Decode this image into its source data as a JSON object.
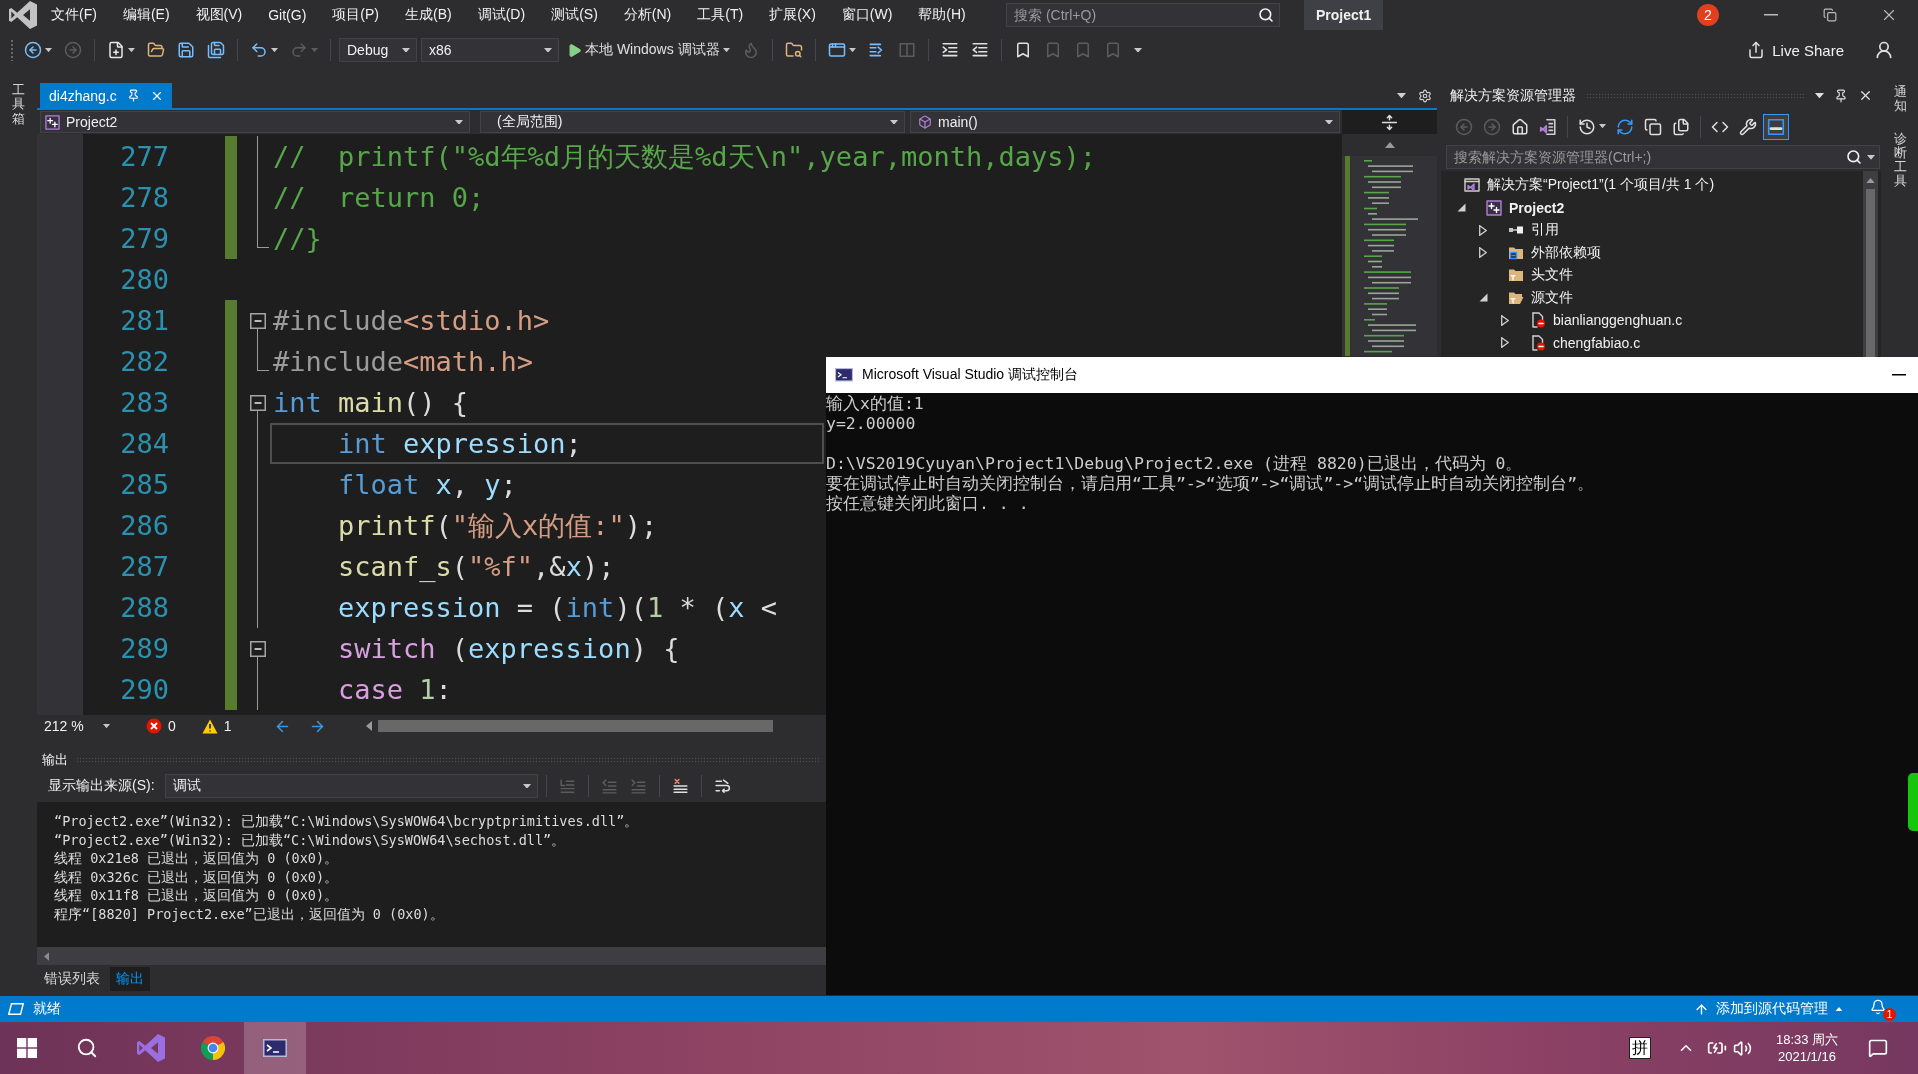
{
  "title_bar": {
    "menus": [
      "文件(F)",
      "编辑(E)",
      "视图(V)",
      "Git(G)",
      "项目(P)",
      "生成(B)",
      "调试(D)",
      "测试(S)",
      "分析(N)",
      "工具(T)",
      "扩展(X)",
      "窗口(W)",
      "帮助(H)"
    ],
    "search": {
      "placeholder": "搜索 (Ctrl+Q)"
    },
    "solution": "Project1",
    "badge": "2"
  },
  "toolbar": {
    "groups": [
      [
        {
          "kind": "back",
          "disabled": false
        },
        {
          "kind": "forward",
          "disabled": true
        }
      ],
      [
        {
          "kind": "new-item",
          "disabled": false
        },
        {
          "kind": "open",
          "disabled": false
        },
        {
          "kind": "save",
          "disabled": false
        },
        {
          "kind": "save-all",
          "disabled": false
        }
      ],
      [
        {
          "kind": "undo",
          "disabled": false
        },
        {
          "kind": "redo",
          "disabled": true
        }
      ],
      [
        {
          "kind": "configuration",
          "text": "Debug"
        },
        {
          "kind": "platform",
          "text": "x86"
        },
        {
          "kind": "run",
          "text": "本地 Windows 调试器"
        },
        {
          "kind": "hot-reload",
          "disabled": true
        }
      ],
      [
        {
          "kind": "find-in-folder",
          "disabled": false
        }
      ],
      [
        {
          "kind": "browser",
          "disabled": false
        },
        {
          "kind": "step-into",
          "disabled": false
        },
        {
          "kind": "step-out",
          "disabled": true
        }
      ],
      [
        {
          "kind": "indent",
          "disabled": false
        },
        {
          "kind": "outdent",
          "disabled": false
        }
      ],
      [
        {
          "kind": "bookmark",
          "disabled": false
        },
        {
          "kind": "previous-bookmark",
          "disabled": true
        },
        {
          "kind": "next-bookmark",
          "disabled": true
        },
        {
          "kind": "clear-bookmarks",
          "disabled": true
        }
      ]
    ],
    "live_share": "Live Share"
  },
  "toolbox": {
    "label": "工具箱"
  },
  "editor": {
    "tab": {
      "title": "di4zhang.c",
      "selected": true
    },
    "navigation": {
      "project": "Project2",
      "scope": "(全局范围)",
      "member": "main()"
    },
    "lines": [
      {
        "number": "277",
        "kind": "inside",
        "changed": true,
        "current": false,
        "indented": false,
        "tokens": [
          {
            "kind": "comment",
            "text": "//  printf(\"%d年%d月的天数是%d天\\n\",year,month,days);"
          }
        ]
      },
      {
        "number": "278",
        "kind": "inside",
        "changed": true,
        "current": false,
        "indented": false,
        "tokens": [
          {
            "kind": "comment",
            "text": "//  return 0;"
          }
        ]
      },
      {
        "number": "279",
        "kind": "end",
        "changed": true,
        "current": false,
        "indented": false,
        "tokens": [
          {
            "kind": "comment",
            "text": "//}"
          }
        ]
      },
      {
        "number": "280",
        "kind": "outside",
        "changed": false,
        "current": false
      },
      {
        "number": "281",
        "kind": "start",
        "changed": true,
        "current": false,
        "indented": false,
        "tokens": [
          {
            "kind": "preproc",
            "text": "#include"
          },
          {
            "kind": "string",
            "text": "<stdio.h>"
          }
        ]
      },
      {
        "number": "282",
        "kind": "end",
        "changed": true,
        "current": false,
        "indented": false,
        "tokens": [
          {
            "kind": "preproc",
            "text": "#include"
          },
          {
            "kind": "string",
            "text": "<math.h>"
          }
        ]
      },
      {
        "number": "283",
        "kind": "start",
        "changed": true,
        "current": false,
        "indented": false,
        "tokens": [
          {
            "kind": "keyword",
            "text": "int "
          },
          {
            "kind": "function",
            "text": "main"
          },
          {
            "kind": "plain",
            "text": "() {"
          }
        ]
      },
      {
        "number": "284",
        "kind": "inside",
        "changed": true,
        "current": true,
        "indented": true,
        "tokens": [
          {
            "kind": "keyword",
            "text": "int "
          },
          {
            "kind": "variable",
            "text": "expression"
          },
          {
            "kind": "plain",
            "text": ";"
          }
        ]
      },
      {
        "number": "285",
        "kind": "inside",
        "changed": true,
        "current": false,
        "indented": true,
        "tokens": [
          {
            "kind": "keyword",
            "text": "float "
          },
          {
            "kind": "variable",
            "text": "x"
          },
          {
            "kind": "plain",
            "text": ", "
          },
          {
            "kind": "variable",
            "text": "y"
          },
          {
            "kind": "plain",
            "text": ";"
          }
        ]
      },
      {
        "number": "286",
        "kind": "inside",
        "changed": true,
        "current": false,
        "indented": true,
        "tokens": [
          {
            "kind": "function",
            "text": "printf"
          },
          {
            "kind": "plain",
            "text": "("
          },
          {
            "kind": "string",
            "text": "\"输入x的值:\""
          },
          {
            "kind": "plain",
            "text": ");"
          }
        ]
      },
      {
        "number": "287",
        "kind": "inside",
        "changed": true,
        "current": false,
        "indented": true,
        "tokens": [
          {
            "kind": "function",
            "text": "scanf_s"
          },
          {
            "kind": "plain",
            "text": "("
          },
          {
            "kind": "string",
            "text": "\"%f\""
          },
          {
            "kind": "plain",
            "text": ",&"
          },
          {
            "kind": "variable",
            "text": "x"
          },
          {
            "kind": "plain",
            "text": ");"
          }
        ]
      },
      {
        "number": "288",
        "kind": "inside",
        "changed": true,
        "current": false,
        "indented": true,
        "tokens": [
          {
            "kind": "variable",
            "text": "expression"
          },
          {
            "kind": "plain",
            "text": " = ("
          },
          {
            "kind": "keyword",
            "text": "int"
          },
          {
            "kind": "plain",
            "text": ")("
          },
          {
            "kind": "number",
            "text": "1"
          },
          {
            "kind": "plain",
            "text": " * ("
          },
          {
            "kind": "variable",
            "text": "x"
          },
          {
            "kind": "plain",
            "text": " <"
          }
        ]
      },
      {
        "number": "289",
        "kind": "start",
        "changed": true,
        "current": false,
        "indented": true,
        "tokens": [
          {
            "kind": "control",
            "text": "switch "
          },
          {
            "kind": "plain",
            "text": "("
          },
          {
            "kind": "variable",
            "text": "expression"
          },
          {
            "kind": "plain",
            "text": ") {"
          }
        ]
      },
      {
        "number": "290",
        "kind": "inside",
        "changed": true,
        "current": false,
        "indented": true,
        "tokens": [
          {
            "kind": "control",
            "text": "case "
          },
          {
            "kind": "number",
            "text": "1"
          },
          {
            "kind": "plain",
            "text": ":"
          }
        ]
      }
    ],
    "status": {
      "zoom": "212 %",
      "errors": "0",
      "warnings": "1"
    }
  },
  "output": {
    "title": "输出",
    "source_label": "显示输出来源(S):",
    "source": "调试",
    "tool_groups": [
      [
        {
          "kind": "find-message",
          "disabled": true
        }
      ],
      [
        {
          "kind": "previous",
          "disabled": true
        },
        {
          "kind": "next",
          "disabled": true
        }
      ],
      [
        {
          "kind": "clear",
          "disabled": false
        }
      ],
      [
        {
          "kind": "word-wrap",
          "disabled": false
        }
      ]
    ],
    "lines": [
      "“Project2.exe”(Win32): 已加载“C:\\Windows\\SysWOW64\\bcryptprimitives.dll”。",
      "“Project2.exe”(Win32): 已加载“C:\\Windows\\SysWOW64\\sechost.dll”。",
      "线程 0x21e8 已退出，返回值为 0 (0x0)。",
      "线程 0x326c 已退出，返回值为 0 (0x0)。",
      "线程 0x11f8 已退出，返回值为 0 (0x0)。",
      "程序“[8820] Project2.exe”已退出，返回值为 0 (0x0)。"
    ],
    "tabs": [
      {
        "label": "错误列表",
        "selected": false
      },
      {
        "label": "输出",
        "selected": true
      }
    ]
  },
  "solution_explorer": {
    "title": "解决方案资源管理器",
    "tool_groups": [
      [
        {
          "kind": "back",
          "disabled": true,
          "on": false
        },
        {
          "kind": "forward",
          "disabled": true,
          "on": false
        },
        {
          "kind": "home",
          "disabled": false,
          "on": false
        },
        {
          "kind": "switch-views",
          "disabled": false,
          "on": false
        }
      ],
      [
        {
          "kind": "history",
          "disabled": false,
          "on": false
        },
        {
          "kind": "sync",
          "disabled": false,
          "on": false
        },
        {
          "kind": "collapse",
          "disabled": false,
          "on": false
        },
        {
          "kind": "show-all",
          "disabled": false,
          "on": false
        }
      ],
      [
        {
          "kind": "code",
          "disabled": false,
          "on": false
        },
        {
          "kind": "properties",
          "disabled": false,
          "on": false
        },
        {
          "kind": "preview",
          "disabled": false,
          "on": true
        }
      ]
    ],
    "search": {
      "placeholder": "搜索解决方案资源管理器(Ctrl+;)"
    },
    "tree": [
      {
        "label": "解决方案“Project1”(1 个项目/共 1 个)",
        "kind": "solution",
        "children": [
          {
            "label": "Project2",
            "kind": "project",
            "expanded": true,
            "children": [
              {
                "label": "引用",
                "kind": "references",
                "expanded": false
              },
              {
                "label": "外部依赖项",
                "kind": "dependencies",
                "expanded": false
              },
              {
                "label": "头文件",
                "kind": "filter"
              },
              {
                "label": "源文件",
                "kind": "filter",
                "expanded": true,
                "children": [
                  {
                    "label": "bianlianggenghuan.c",
                    "kind": "file",
                    "expanded": false
                  },
                  {
                    "label": "chengfabiao.c",
                    "kind": "file",
                    "expanded": false
                  }
                ]
              }
            ]
          }
        ]
      }
    ]
  },
  "side_tabs": [
    "通知",
    "诊断工具"
  ],
  "console": {
    "title": "Microsoft Visual Studio 调试控制台",
    "blocks": [
      [
        "输入x的值:1",
        "y=2.00000"
      ],
      [
        "D:\\VS2019Cyuyan\\Project1\\Debug\\Project2.exe (进程 8820)已退出，代码为 0。",
        "要在调试停止时自动关闭控制台，请启用“工具”->“选项”->“调试”->“调试停止时自动关闭控制台”。",
        "按任意键关闭此窗口. . ."
      ]
    ]
  },
  "status_bar": {
    "status": "就绪",
    "source_control": "添加到源代码管理",
    "notifications": "1"
  },
  "taskbar": {
    "apps": [
      {
        "kind": "ide",
        "selected": false
      },
      {
        "kind": "browser",
        "selected": false
      },
      {
        "kind": "console",
        "selected": true
      }
    ],
    "ime": "拼",
    "time": "18:33 周六",
    "date": "2021/1/16"
  }
}
